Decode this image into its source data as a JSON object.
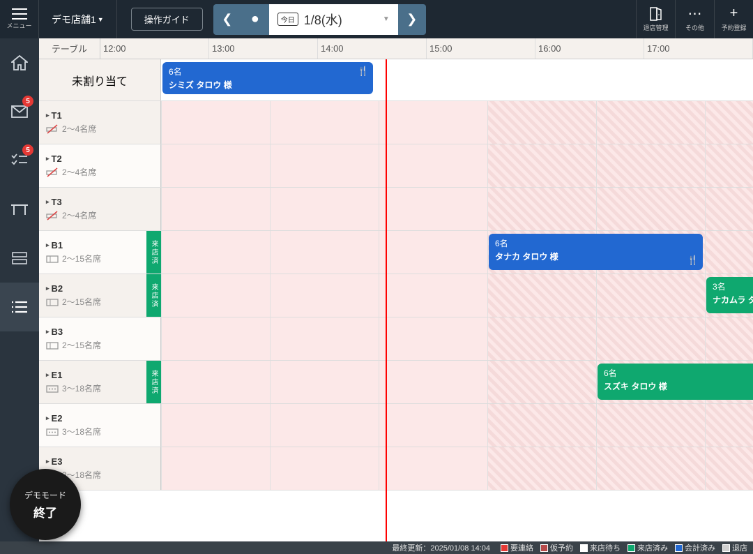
{
  "header": {
    "menu_label": "メニュー",
    "store": "デモ店舗1",
    "guide": "操作ガイド",
    "today_chip": "今日",
    "date": "1/8(水)",
    "leave_mgmt": "退店管理",
    "other": "その他",
    "add_resv": "予約登録"
  },
  "sidebar": {
    "badge_mail": "5",
    "badge_tasks": "5"
  },
  "grid": {
    "corner": "テーブル",
    "hours": [
      "12:00",
      "13:00",
      "14:00",
      "15:00",
      "16:00",
      "17:00"
    ],
    "unassigned": "未割り当て",
    "status_flag": "来店済",
    "tables": [
      {
        "name": "T1",
        "cap": "2～4名席",
        "icon": "nosmoking"
      },
      {
        "name": "T2",
        "cap": "2～4名席",
        "icon": "nosmoking"
      },
      {
        "name": "T3",
        "cap": "2～4名席",
        "icon": "nosmoking"
      },
      {
        "name": "B1",
        "cap": "2～15名席",
        "icon": "room",
        "flag": true
      },
      {
        "name": "B2",
        "cap": "2～15名席",
        "icon": "room",
        "flag": true
      },
      {
        "name": "B3",
        "cap": "2～15名席",
        "icon": "room"
      },
      {
        "name": "E1",
        "cap": "3～18名席",
        "icon": "tatami",
        "flag": true
      },
      {
        "name": "E2",
        "cap": "3～18名席",
        "icon": "tatami"
      },
      {
        "name": "E3",
        "cap": "3～18名席",
        "icon": "tatami"
      }
    ]
  },
  "reservations": {
    "r1": {
      "count": "6名",
      "name": "シミズ タロウ 様"
    },
    "r2": {
      "count": "6名",
      "name": "タナカ タロウ 様"
    },
    "r3": {
      "count": "3名",
      "name": "ナカムラ タ"
    },
    "r4": {
      "count": "6名",
      "name": "スズキ タロウ 様"
    }
  },
  "footer": {
    "updated_label": "最終更新：",
    "updated_time": "2025/01/08 14:04",
    "legend": {
      "l1": "要連絡",
      "c1": "#e53935",
      "l2": "仮予約",
      "c2": "#b74a4a",
      "l3": "来店待ち",
      "c3": "#ffffff",
      "l4": "来店済み",
      "c4": "#0fa86f",
      "l5": "会計済み",
      "c5": "#2268d1",
      "l6": "退店",
      "c6": "#d0d0d0"
    }
  },
  "demo": {
    "l1": "デモモード",
    "l2": "終了"
  }
}
